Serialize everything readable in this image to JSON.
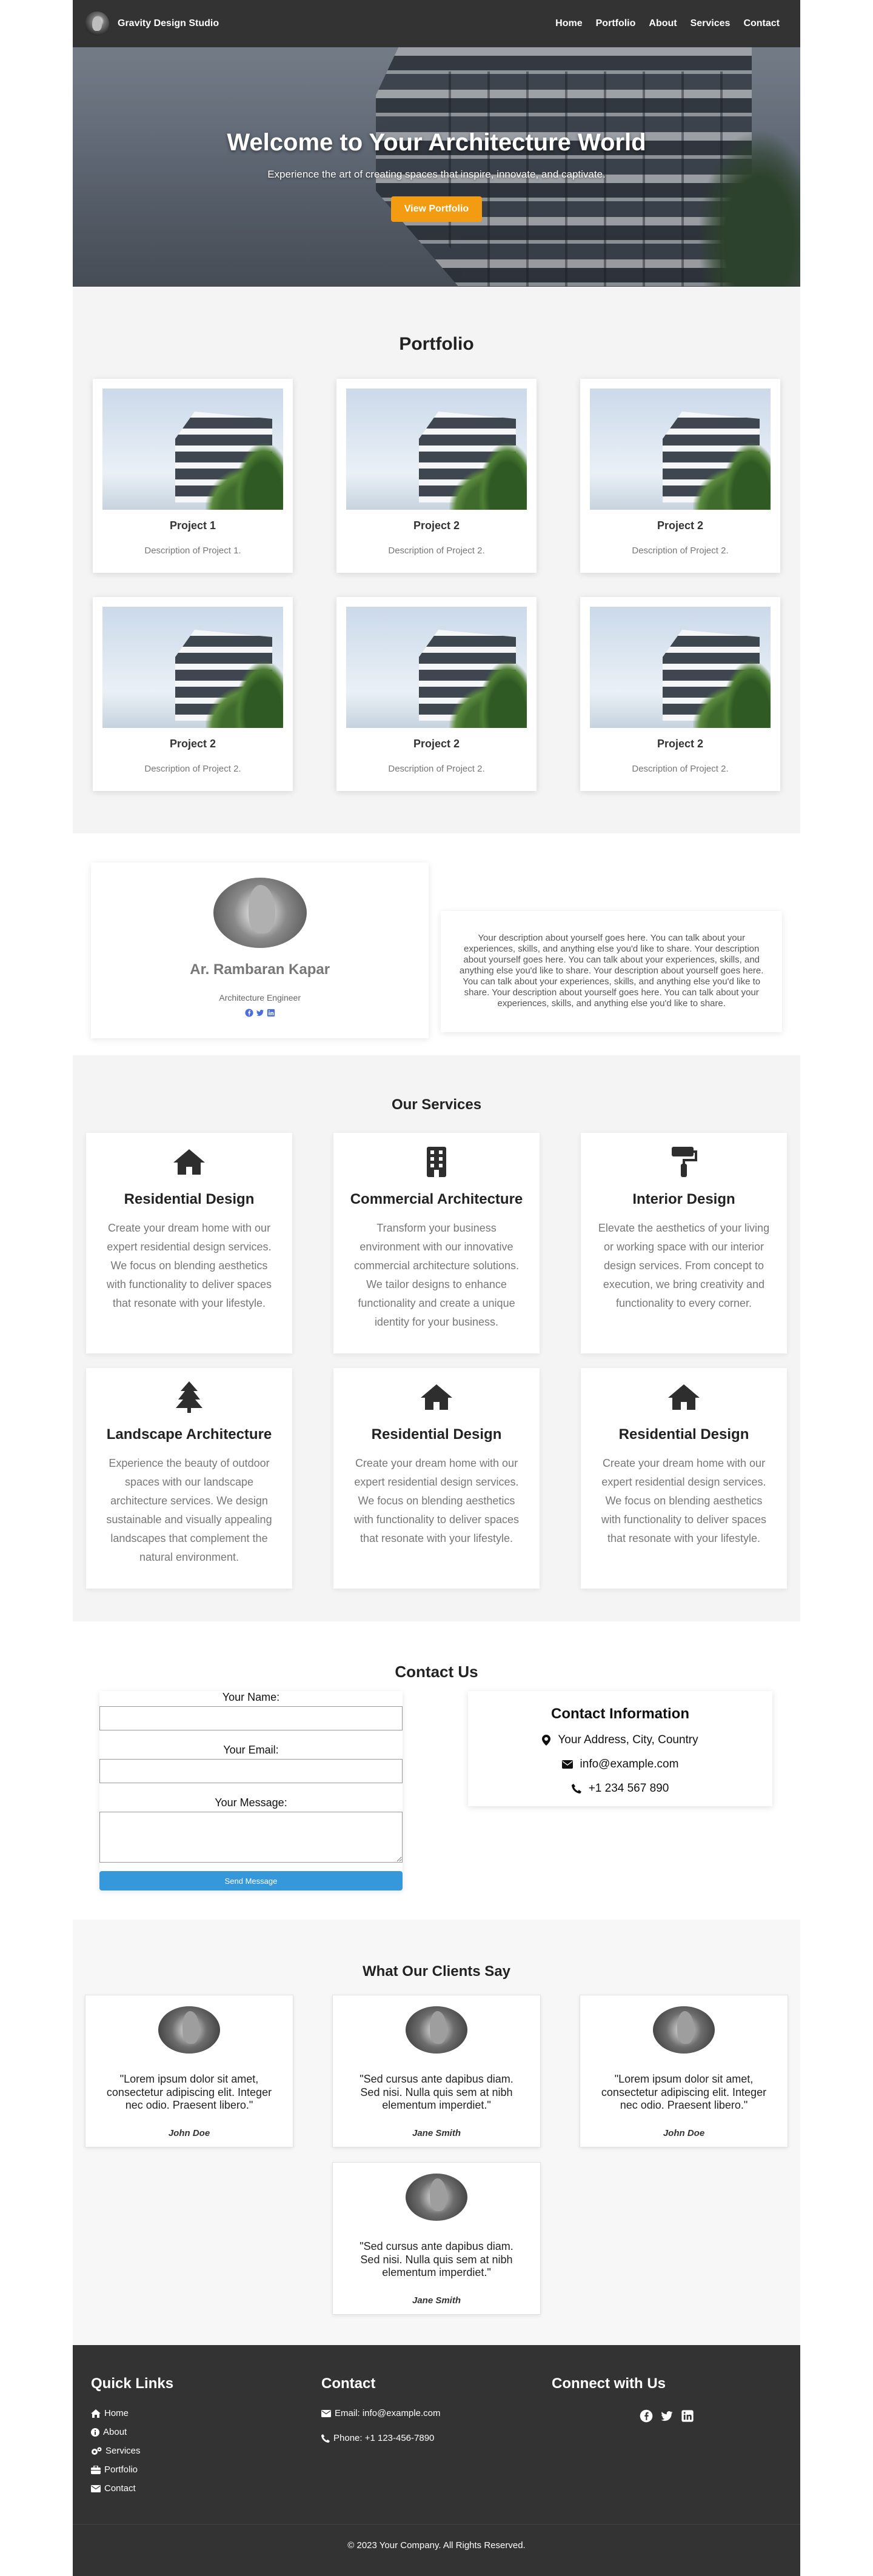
{
  "nav": {
    "brand": "Gravity Design Studio",
    "links": [
      "Home",
      "Portfolio",
      "About",
      "Services",
      "Contact"
    ]
  },
  "hero": {
    "title": "Welcome to Your Architecture World",
    "subtitle": "Experience the art of creating spaces that inspire, innovate, and captivate.",
    "button": "View Portfolio"
  },
  "portfolio": {
    "title": "Portfolio",
    "items": [
      {
        "title": "Project 1",
        "desc": "Description of Project 1."
      },
      {
        "title": "Project 2",
        "desc": "Description of Project 2."
      },
      {
        "title": "Project 2",
        "desc": "Description of Project 2."
      },
      {
        "title": "Project 2",
        "desc": "Description of Project 2."
      },
      {
        "title": "Project 2",
        "desc": "Description of Project 2."
      },
      {
        "title": "Project 2",
        "desc": "Description of Project 2."
      }
    ]
  },
  "profile": {
    "name": "Ar. Rambaran Kapar",
    "role": "Architecture Engineer",
    "description": "Your description about yourself goes here. You can talk about your experiences, skills, and anything else you'd like to share. Your description about yourself goes here. You can talk about your experiences, skills, and anything else you'd like to share. Your description about yourself goes here. You can talk about your experiences, skills, and anything else you'd like to share. Your description about yourself goes here. You can talk about your experiences, skills, and anything else you'd like to share."
  },
  "services": {
    "title": "Our Services",
    "items": [
      {
        "icon": "home-icon",
        "title": "Residential Design",
        "desc": "Create your dream home with our expert residential design services. We focus on blending aesthetics with functionality to deliver spaces that resonate with your lifestyle."
      },
      {
        "icon": "building-icon",
        "title": "Commercial Architecture",
        "desc": "Transform your business environment with our innovative commercial architecture solutions. We tailor designs to enhance functionality and create a unique identity for your business."
      },
      {
        "icon": "paint-roller-icon",
        "title": "Interior Design",
        "desc": "Elevate the aesthetics of your living or working space with our interior design services. From concept to execution, we bring creativity and functionality to every corner."
      },
      {
        "icon": "tree-icon",
        "title": "Landscape Architecture",
        "desc": "Experience the beauty of outdoor spaces with our landscape architecture services. We design sustainable and visually appealing landscapes that complement the natural environment."
      },
      {
        "icon": "home-icon",
        "title": "Residential Design",
        "desc": "Create your dream home with our expert residential design services. We focus on blending aesthetics with functionality to deliver spaces that resonate with your lifestyle."
      },
      {
        "icon": "home-icon",
        "title": "Residential Design",
        "desc": "Create your dream home with our expert residential design services. We focus on blending aesthetics with functionality to deliver spaces that resonate with your lifestyle."
      }
    ]
  },
  "contact": {
    "title": "Contact Us",
    "name_label": "Your Name:",
    "email_label": "Your Email:",
    "message_label": "Your Message:",
    "name_value": "",
    "email_value": "",
    "message_value": "",
    "send_button": "Send Message",
    "info_title": "Contact Information",
    "address": "Your Address, City, Country",
    "email": "info@example.com",
    "phone": "+1 234 567 890"
  },
  "testimonials": {
    "title": "What Our Clients Say",
    "items": [
      {
        "quote": "\"Lorem ipsum dolor sit amet, consectetur adipiscing elit. Integer nec odio. Praesent libero.\"",
        "author": "John Doe"
      },
      {
        "quote": "\"Sed cursus ante dapibus diam. Sed nisi. Nulla quis sem at nibh elementum imperdiet.\"",
        "author": "Jane Smith"
      },
      {
        "quote": "\"Lorem ipsum dolor sit amet, consectetur adipiscing elit. Integer nec odio. Praesent libero.\"",
        "author": "John Doe"
      },
      {
        "quote": "\"Sed cursus ante dapibus diam. Sed nisi. Nulla quis sem at nibh elementum imperdiet.\"",
        "author": "Jane Smith"
      }
    ]
  },
  "footer": {
    "quick_links_title": "Quick Links",
    "quick_links": [
      {
        "icon": "home-icon",
        "label": "Home"
      },
      {
        "icon": "info-icon",
        "label": "About"
      },
      {
        "icon": "gears-icon",
        "label": "Services"
      },
      {
        "icon": "briefcase-icon",
        "label": "Portfolio"
      },
      {
        "icon": "envelope-icon",
        "label": "Contact"
      }
    ],
    "contact_title": "Contact",
    "contact_email": "Email: info@example.com",
    "contact_phone": "Phone: +1 123-456-7890",
    "connect_title": "Connect with Us",
    "copyright": "© 2023 Your Company. All Rights Reserved."
  },
  "colors": {
    "nav_bg": "#333333",
    "accent": "#f39c12",
    "button_blue": "#3498db",
    "section_gray": "#f4f4f4"
  }
}
